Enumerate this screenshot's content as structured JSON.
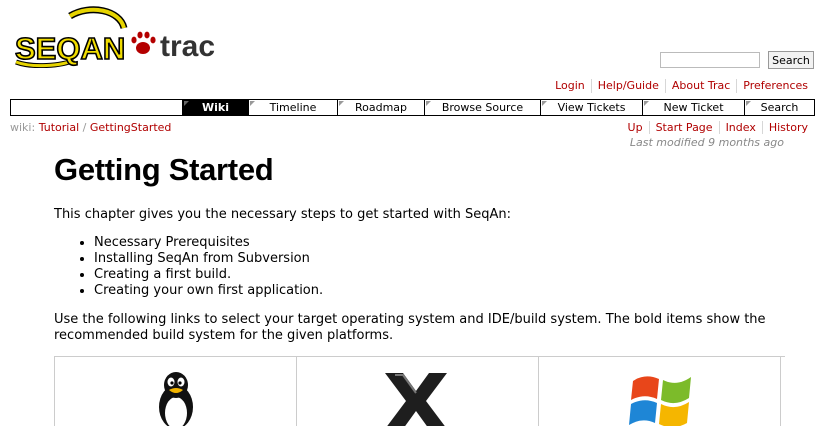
{
  "logo": {
    "text": "SEQAN trac"
  },
  "search": {
    "placeholder": "",
    "button_label": "Search"
  },
  "metanav": [
    "Login",
    "Help/Guide",
    "About Trac",
    "Preferences"
  ],
  "mainnav": {
    "tabs": [
      {
        "label": "Wiki",
        "active": true
      },
      {
        "label": "Timeline"
      },
      {
        "label": "Roadmap"
      },
      {
        "label": "Browse Source"
      },
      {
        "label": "View Tickets"
      },
      {
        "label": "New Ticket"
      },
      {
        "label": "Search"
      }
    ]
  },
  "breadcrumb": {
    "prefix": "wiki:",
    "items": [
      "Tutorial",
      "GettingStarted"
    ],
    "separator": "/"
  },
  "ctxtnav": [
    "Up",
    "Start Page",
    "Index",
    "History"
  ],
  "last_modified": {
    "label": "Last modified",
    "ago": "9 months ago"
  },
  "page": {
    "title": "Getting Started",
    "intro": "This chapter gives you the necessary steps to get started with SeqAn:",
    "steps": [
      "Necessary Prerequisites",
      "Installing SeqAn from Subversion",
      "Creating a first build.",
      "Creating your own first application."
    ],
    "paragraph": "Use the following links to select your target operating system and IDE/build system. The bold items show the recommended build system for the given platforms."
  },
  "platforms": [
    {
      "icon": "linux-tux-icon"
    },
    {
      "icon": "mac-x-icon"
    },
    {
      "icon": "windows-flag-icon"
    }
  ]
}
